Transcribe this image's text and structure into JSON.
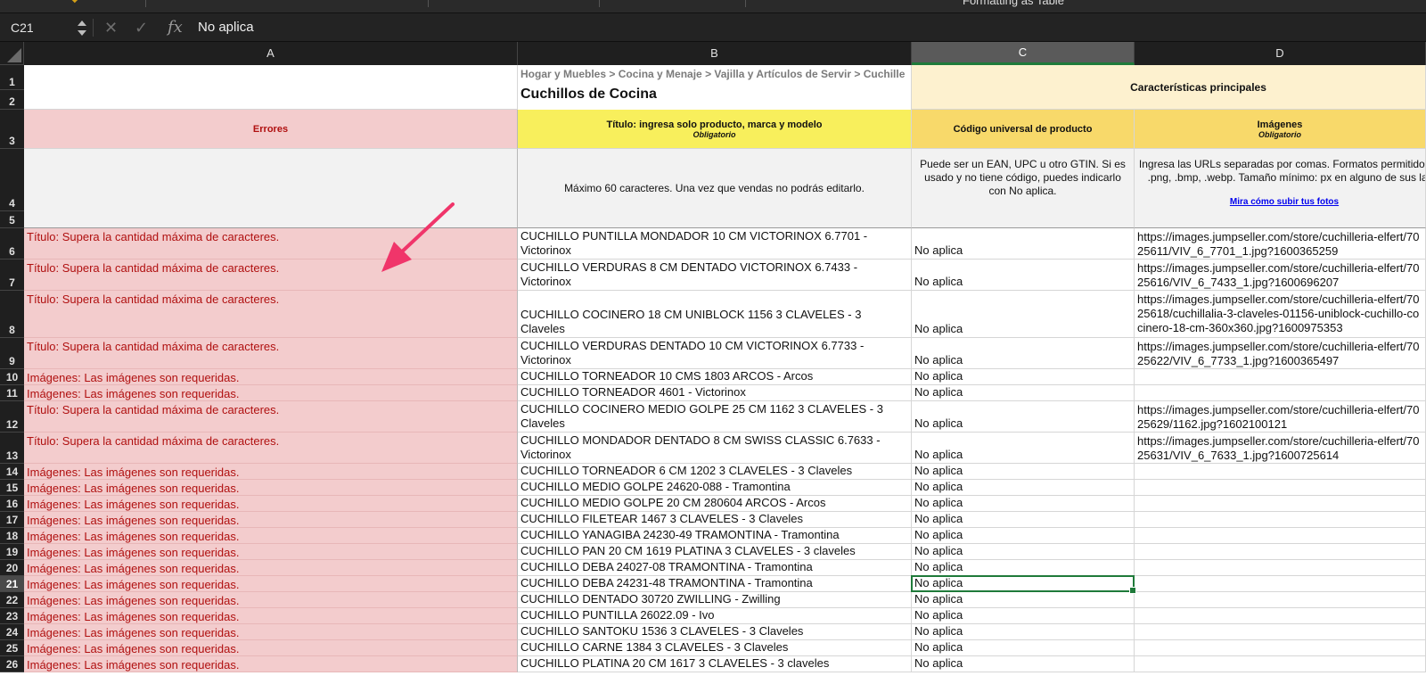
{
  "ribbon": {
    "format_label": "Formatting  as Table"
  },
  "formula_bar": {
    "name_box": "C21",
    "value": "No aplica",
    "icons": [
      "cancel-icon",
      "confirm-icon",
      "fx-icon"
    ]
  },
  "columns": [
    {
      "key": "A",
      "label": "A"
    },
    {
      "key": "B",
      "label": "B"
    },
    {
      "key": "C",
      "label": "C"
    },
    {
      "key": "D",
      "label": "D"
    }
  ],
  "header": {
    "breadcrumb": "Hogar y Muebles > Cocina y Menaje > Vajilla y Artículos de Servir > Cuchille",
    "category_title": "Cuchillos de Cocina",
    "main_features": "Características principales",
    "errors_label": "Errores",
    "title_col": {
      "label": "Título: ingresa solo producto, marca y modelo",
      "note": "Obligatorio",
      "hint": "Máximo 60 caracteres. Una vez que vendas no podrás editarlo."
    },
    "upc_col": {
      "label": "Código universal de producto",
      "hint": "Puede ser un EAN, UPC u otro GTIN. Si es usado y no tiene código, puedes indicarlo con No aplica."
    },
    "images_col": {
      "label": "Imágenes",
      "note": "Obligatorio",
      "hint": "Ingresa las URLs separadas por comas. Formatos permitidos: .jpg, .png, .bmp, .webp. Tamaño mínimo: px en alguno de sus lados.",
      "link": "Mira cómo subir tus fotos"
    }
  },
  "row_numbers": [
    "1",
    "2",
    "3",
    "4",
    "5",
    "6",
    "7",
    "8",
    "9",
    "10",
    "11",
    "12",
    "13",
    "14",
    "15",
    "16",
    "17",
    "18",
    "19",
    "20",
    "21",
    "22",
    "23",
    "24",
    "25",
    "26"
  ],
  "rows": [
    {
      "n": "6",
      "error": "Título: Supera la cantidad máxima de caracteres.",
      "title": "CUCHILLO PUNTILLA MONDADOR 10 CM VICTORINOX 6.7701 - Victorinox",
      "upc": "No aplica",
      "image": "https://images.jumpseller.com/store/cuchilleria-elfert/7025611/VIV_6_7701_1.jpg?1600365259"
    },
    {
      "n": "7",
      "error": "Título: Supera la cantidad máxima de caracteres.",
      "title": "CUCHILLO VERDURAS 8 CM DENTADO VICTORINOX 6.7433 - Victorinox",
      "upc": "No aplica",
      "image": "https://images.jumpseller.com/store/cuchilleria-elfert/7025616/VIV_6_7433_1.jpg?1600696207"
    },
    {
      "n": "8",
      "error": "Título: Supera la cantidad máxima de caracteres.",
      "title": "CUCHILLO COCINERO 18 CM UNIBLOCK 1156 3 CLAVELES - 3 Claveles",
      "upc": "No aplica",
      "image": "https://images.jumpseller.com/store/cuchilleria-elfert/7025618/cuchillalia-3-claveles-01156-uniblock-cuchillo-cocinero-18-cm-360x360.jpg?1600975353"
    },
    {
      "n": "9",
      "error": "Título: Supera la cantidad máxima de caracteres.",
      "title": "CUCHILLO VERDURAS DENTADO 10 CM VICTORINOX 6.7733 - Victorinox",
      "upc": "No aplica",
      "image": "https://images.jumpseller.com/store/cuchilleria-elfert/7025622/VIV_6_7733_1.jpg?1600365497"
    },
    {
      "n": "10",
      "error": "Imágenes: Las imágenes son requeridas.",
      "title": "CUCHILLO TORNEADOR 10 CMS 1803 ARCOS - Arcos",
      "upc": "No aplica",
      "image": ""
    },
    {
      "n": "11",
      "error": "Imágenes: Las imágenes son requeridas.",
      "title": "CUCHILLO TORNEADOR 4601 - Victorinox",
      "upc": "No aplica",
      "image": ""
    },
    {
      "n": "12",
      "error": "Título: Supera la cantidad máxima de caracteres.",
      "title": "CUCHILLO COCINERO MEDIO GOLPE 25 CM 1162 3 CLAVELES - 3 Claveles",
      "upc": "No aplica",
      "image": "https://images.jumpseller.com/store/cuchilleria-elfert/7025629/1162.jpg?1602100121"
    },
    {
      "n": "13",
      "error": "Título: Supera la cantidad máxima de caracteres.",
      "title": "CUCHILLO MONDADOR DENTADO 8 CM SWISS CLASSIC 6.7633 - Victorinox",
      "upc": "No aplica",
      "image": "https://images.jumpseller.com/store/cuchilleria-elfert/7025631/VIV_6_7633_1.jpg?1600725614"
    },
    {
      "n": "14",
      "error": "Imágenes: Las imágenes son requeridas.",
      "title": "CUCHILLO TORNEADOR 6 CM 1202 3 CLAVELES - 3 Claveles",
      "upc": "No aplica",
      "image": ""
    },
    {
      "n": "15",
      "error": "Imágenes: Las imágenes son requeridas.",
      "title": "CUCHILLO MEDIO GOLPE 24620-088 - Tramontina",
      "upc": "No aplica",
      "image": ""
    },
    {
      "n": "16",
      "error": "Imágenes: Las imágenes son requeridas.",
      "title": "CUCHILLO MEDIO GOLPE 20 CM 280604 ARCOS - Arcos",
      "upc": "No aplica",
      "image": ""
    },
    {
      "n": "17",
      "error": "Imágenes: Las imágenes son requeridas.",
      "title": "CUCHILLO FILETEAR 1467 3 CLAVELES - 3 Claveles",
      "upc": "No aplica",
      "image": ""
    },
    {
      "n": "18",
      "error": "Imágenes: Las imágenes son requeridas.",
      "title": "CUCHILLO YANAGIBA 24230-49 TRAMONTINA - Tramontina",
      "upc": "No aplica",
      "image": ""
    },
    {
      "n": "19",
      "error": "Imágenes: Las imágenes son requeridas.",
      "title": "CUCHILLO PAN 20 CM 1619 PLATINA 3 CLAVELES - 3 claveles",
      "upc": "No aplica",
      "image": ""
    },
    {
      "n": "20",
      "error": "Imágenes: Las imágenes son requeridas.",
      "title": "CUCHILLO DEBA 24027-08 TRAMONTINA - Tramontina",
      "upc": "No aplica",
      "image": ""
    },
    {
      "n": "21",
      "error": "Imágenes: Las imágenes son requeridas.",
      "title": "CUCHILLO DEBA 24231-48 TRAMONTINA - Tramontina",
      "upc": "No aplica",
      "image": ""
    },
    {
      "n": "22",
      "error": "Imágenes: Las imágenes son requeridas.",
      "title": "CUCHILLO DENTADO 30720 ZWILLING - Zwilling",
      "upc": "No aplica",
      "image": ""
    },
    {
      "n": "23",
      "error": "Imágenes: Las imágenes son requeridas.",
      "title": "CUCHILLO PUNTILLA 26022.09 - Ivo",
      "upc": "No aplica",
      "image": ""
    },
    {
      "n": "24",
      "error": "Imágenes: Las imágenes son requeridas.",
      "title": "CUCHILLO SANTOKU 1536 3 CLAVELES - 3 Claveles",
      "upc": "No aplica",
      "image": ""
    },
    {
      "n": "25",
      "error": "Imágenes: Las imágenes son requeridas.",
      "title": "CUCHILLO CARNE 1384 3 CLAVELES - 3 Claveles",
      "upc": "No aplica",
      "image": ""
    },
    {
      "n": "26",
      "error": "Imágenes: Las imágenes son requeridas.",
      "title": "CUCHILLO PLATINA 20 CM 1617 3 CLAVELES - 3 claveles",
      "upc": "No aplica",
      "image": ""
    }
  ],
  "selection": {
    "cell": "C21",
    "column": "C",
    "row": "21"
  },
  "colors": {
    "error_fill": "#f3cccd",
    "error_text": "#b01010",
    "title_header": "#f8ef5c",
    "feature_header": "#f8d96a",
    "feature_band": "#fdf1cf",
    "selection": "#1f7a3a",
    "annotation_arrow": "#f0356a"
  }
}
